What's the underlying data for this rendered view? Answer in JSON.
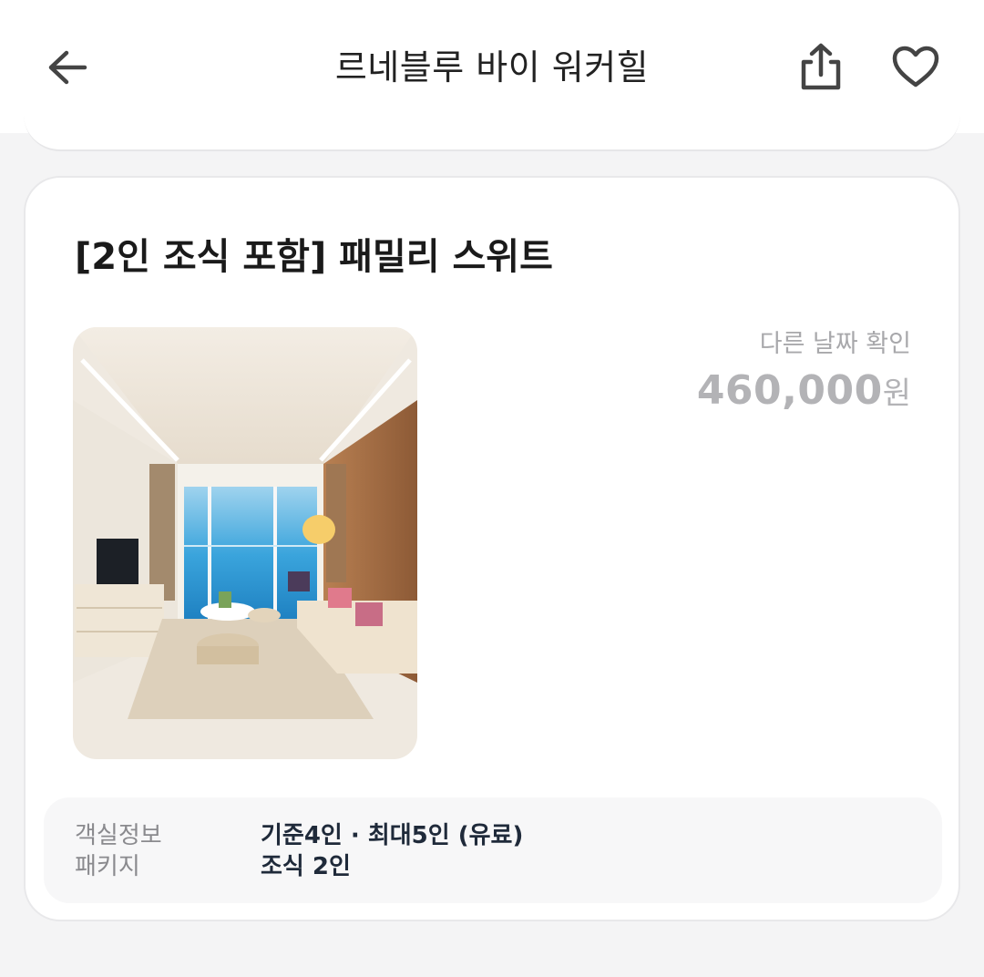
{
  "header": {
    "title": "르네블루 바이 워커힐",
    "back_icon": "back-arrow-icon",
    "share_icon": "share-icon",
    "like_icon": "heart-icon"
  },
  "room": {
    "name": "[2인 조식 포함] 패밀리 스위트",
    "other_date_label": "다른 날짜 확인",
    "price_number": "460,000",
    "price_unit": "원",
    "info": [
      {
        "label": "객실정보",
        "value": "기준4인 · 최대5인 (유료)"
      },
      {
        "label": "패키지",
        "value": "조식 2인"
      }
    ]
  },
  "colors": {
    "background": "#f4f4f5",
    "card": "#ffffff",
    "muted_text": "#a8a8ab",
    "value_text": "#1f2a3a"
  }
}
